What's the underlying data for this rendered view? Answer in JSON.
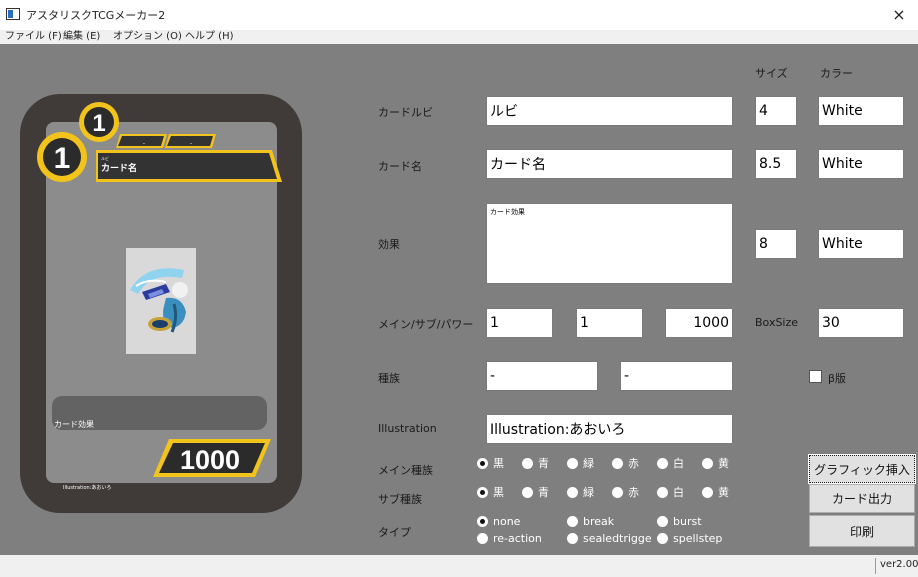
{
  "window": {
    "title": "アスタリスクTCGメーカー2",
    "close_glyph": "×"
  },
  "menu": [
    "ファイル (F)",
    "編集 (E)",
    "オプション (O)",
    "ヘルプ (H)"
  ],
  "status": {
    "version": "ver2.00"
  },
  "card_preview": {
    "cost_main": "1",
    "cost_sub": "1",
    "mini_labels": [
      "-",
      "-"
    ],
    "ruby": "ルビ",
    "name": "カード名",
    "effect": "カード効果",
    "power": "1000",
    "credit": "Illustration:あおいろ"
  },
  "form": {
    "headers": {
      "size": "サイズ",
      "color": "カラー"
    },
    "labels": {
      "ruby": "カードルビ",
      "name": "カード名",
      "effect": "効果",
      "mainsubpower": "メイン/サブ/パワー",
      "race": "種族",
      "illustration": "Illustration",
      "main_race": "メイン種族",
      "sub_race": "サブ種族",
      "type": "タイプ",
      "boxsize": "BoxSize",
      "beta": "β版"
    },
    "ruby": {
      "value": "ルビ",
      "size": "4",
      "color": "White"
    },
    "name": {
      "value": "カード名",
      "size": "8.5",
      "color": "White"
    },
    "effect": {
      "value": "カード効果",
      "size": "8",
      "color": "White"
    },
    "main": "1",
    "sub": "1",
    "power": "1000",
    "boxsize": "30",
    "race1": "-",
    "race2": "-",
    "illustration": "Illustration:あおいろ",
    "beta_checked": false,
    "colors": [
      "黒",
      "青",
      "緑",
      "赤",
      "白",
      "黄"
    ],
    "main_race_selected": "黒",
    "sub_race_selected": "黒",
    "types": [
      "none",
      "break",
      "burst",
      "re-action",
      "sealedtrigge",
      "spellstep"
    ],
    "type_selected": "none"
  },
  "buttons": {
    "graphic": "グラフィック挿入",
    "output": "カード出力",
    "print": "印刷"
  },
  "colors": {
    "workspace": "#7f7f7f",
    "card_frame": "#403b39",
    "card_gold": "#f2c31b",
    "banner_dark": "#333333"
  }
}
